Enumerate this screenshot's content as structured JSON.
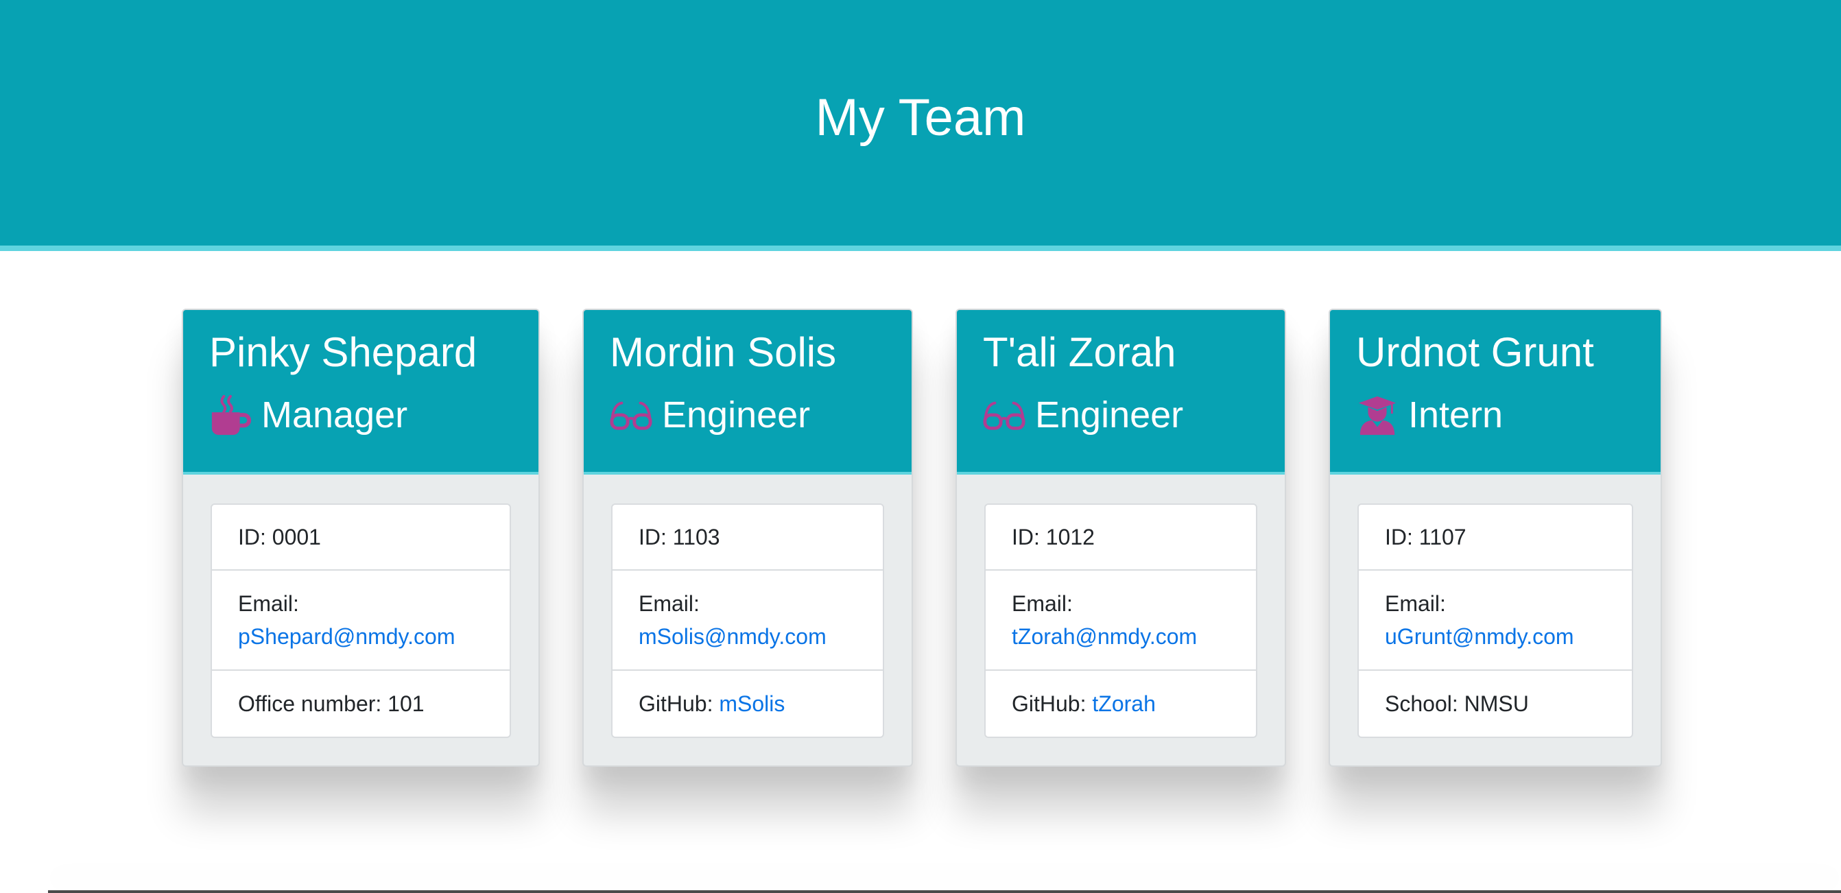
{
  "header": {
    "title": "My Team"
  },
  "employees": [
    {
      "name": "Pinky Shepard",
      "role": "Manager",
      "icon": "coffee-icon",
      "id_text": "ID: 0001",
      "email_label": "Email:",
      "email": "pShepard@nmdy.com",
      "extra_label": "Office number: 101",
      "extra_link": ""
    },
    {
      "name": "Mordin Solis",
      "role": "Engineer",
      "icon": "glasses-icon",
      "id_text": "ID: 1103",
      "email_label": "Email:",
      "email": "mSolis@nmdy.com",
      "extra_label": "GitHub: ",
      "extra_link": "mSolis"
    },
    {
      "name": "T'ali Zorah",
      "role": "Engineer",
      "icon": "glasses-icon",
      "id_text": "ID: 1012",
      "email_label": "Email:",
      "email": "tZorah@nmdy.com",
      "extra_label": "GitHub: ",
      "extra_link": "tZorah"
    },
    {
      "name": "Urdnot Grunt",
      "role": "Intern",
      "icon": "graduate-icon",
      "id_text": "ID: 1107",
      "email_label": "Email:",
      "email": "uGrunt@nmdy.com",
      "extra_label": "School: NMSU",
      "extra_link": ""
    }
  ],
  "colors": {
    "header_bg": "#07a2b3",
    "header_border": "#5fd4df",
    "icon": "#b13d91",
    "link": "#0a74e6"
  }
}
